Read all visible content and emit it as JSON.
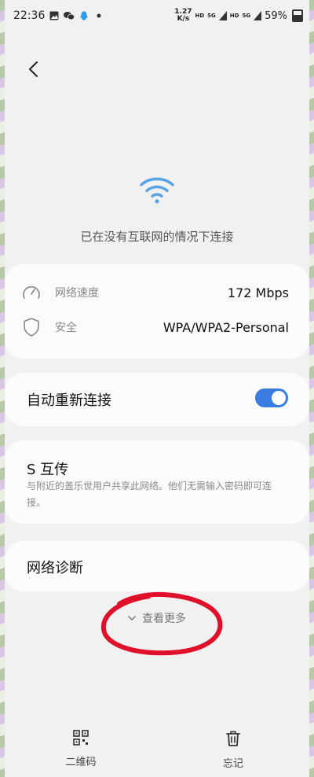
{
  "status_bar": {
    "time": "22:36",
    "net_speed_value": "1.27",
    "net_speed_unit": "K/s",
    "hd1": "HD",
    "net1": "5G",
    "hd2": "HD",
    "net2": "5G",
    "battery": "59%",
    "notification_icons": [
      "gallery-icon",
      "wechat-icon",
      "qq-icon",
      "dot-icon"
    ]
  },
  "wifi": {
    "status_text": "已在没有互联网的情况下连接"
  },
  "info": {
    "speed_label": "网络速度",
    "speed_value": "172 Mbps",
    "security_label": "安全",
    "security_value": "WPA/WPA2-Personal"
  },
  "auto_reconnect": {
    "label": "自动重新连接",
    "enabled": true
  },
  "share": {
    "title": "S 互传",
    "description": "与附近的盖乐世用户共享此网络。他们无需输入密码即可连接。"
  },
  "diagnostics": {
    "label": "网络诊断"
  },
  "see_more": {
    "label": "查看更多"
  },
  "bottom": {
    "qr_label": "二维码",
    "forget_label": "忘记"
  },
  "colors": {
    "accent": "#3a7ce0",
    "wifi_icon": "#5aa4e6",
    "annotation": "#e0102a"
  }
}
